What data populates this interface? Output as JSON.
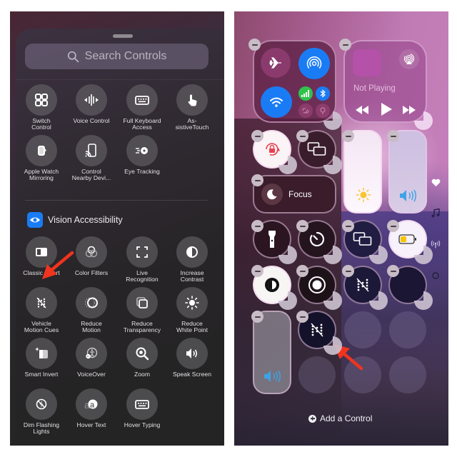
{
  "left": {
    "search": {
      "placeholder": "Search Controls",
      "icon": "search-icon"
    },
    "top_controls": [
      {
        "label": "Switch\nControl",
        "icon": "switch-control-icon"
      },
      {
        "label": "Voice Control",
        "icon": "voice-control-icon"
      },
      {
        "label": "Full Keyboard\nAccess",
        "icon": "keyboard-icon"
      },
      {
        "label": "As-\nsistiveTouch",
        "icon": "assistive-touch-icon"
      },
      {
        "label": "Apple Watch\nMirroring",
        "icon": "apple-watch-icon"
      },
      {
        "label": "Control\nNearby Devi...",
        "icon": "nearby-devices-icon"
      },
      {
        "label": "Eye Tracking",
        "icon": "eye-tracking-icon"
      }
    ],
    "section": {
      "title": "Vision Accessibility",
      "icon": "eye-icon",
      "accent": "#1a7cf5"
    },
    "vision_controls": [
      {
        "label": "Classic Invert",
        "icon": "classic-invert-icon"
      },
      {
        "label": "Color Filters",
        "icon": "color-filters-icon"
      },
      {
        "label": "Live\nRecognition",
        "icon": "live-recognition-icon"
      },
      {
        "label": "Increase\nContrast",
        "icon": "increase-contrast-icon"
      },
      {
        "label": "Vehicle\nMotion Cues",
        "icon": "vehicle-motion-cues-icon"
      },
      {
        "label": "Reduce\nMotion",
        "icon": "reduce-motion-icon"
      },
      {
        "label": "Reduce\nTransparency",
        "icon": "reduce-transparency-icon"
      },
      {
        "label": "Reduce\nWhite Point",
        "icon": "reduce-white-point-icon"
      },
      {
        "label": "Smart Invert",
        "icon": "smart-invert-icon"
      },
      {
        "label": "VoiceOver",
        "icon": "voiceover-icon"
      },
      {
        "label": "Zoom",
        "icon": "zoom-icon"
      },
      {
        "label": "Speak Screen",
        "icon": "speak-screen-icon"
      },
      {
        "label": "Dim Flashing\nLights",
        "icon": "dim-flashing-lights-icon"
      },
      {
        "label": "Hover Text",
        "icon": "hover-text-icon"
      },
      {
        "label": "Hover Typing",
        "icon": "hover-typing-icon"
      }
    ],
    "annotation_color": "#f0341e"
  },
  "right": {
    "connectivity": {
      "airplane": "airplane-mode-icon",
      "airdrop": "airdrop-icon",
      "wifi": "wifi-icon",
      "cellular": "cellular-icon",
      "bluetooth": "bluetooth-icon",
      "colors": {
        "blue": "#1a7cf5",
        "green": "#30c24a"
      }
    },
    "media": {
      "status": "Not Playing",
      "airplay": "airplay-icon"
    },
    "focus": {
      "label": "Focus",
      "icon": "moon-icon"
    },
    "tiles": [
      "orientation-lock-icon",
      "screen-mirroring-icon",
      "brightness-slider",
      "volume-slider",
      "flashlight-icon",
      "timer-icon",
      "screen-mirroring-icon",
      "low-power-mode-icon",
      "dark-mode-icon",
      "screen-recording-icon",
      "vehicle-motion-cues-icon",
      "empty-tile"
    ],
    "new_tile": "vehicle-motion-cues-icon",
    "add_control": "Add a Control",
    "page_indicators": [
      "heart-icon",
      "music-note-icon",
      "antenna-icon",
      "circle-icon"
    ]
  }
}
